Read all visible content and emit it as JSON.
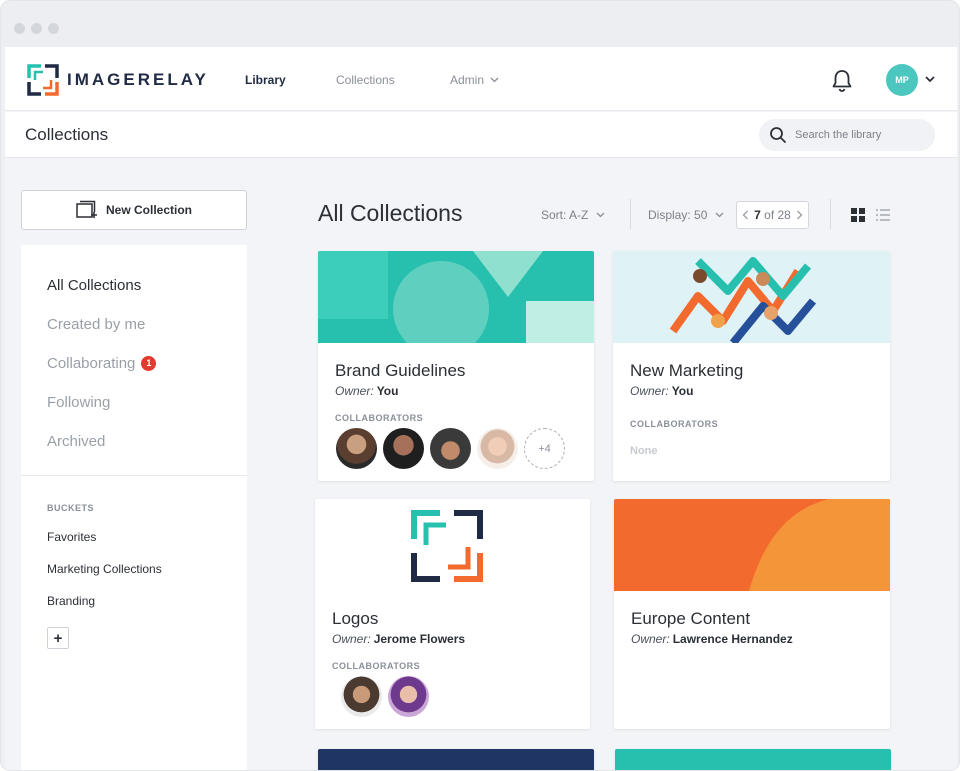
{
  "app": {
    "brand": "IMAGERELAY",
    "nav": [
      {
        "label": "Library",
        "active": true
      },
      {
        "label": "Collections",
        "active": false
      },
      {
        "label": "Admin",
        "active": false
      }
    ],
    "user_initials": "MP"
  },
  "subheader": {
    "title": "Collections",
    "search_placeholder": "Search the library"
  },
  "sidebar": {
    "new_collection_label": "New Collection",
    "items": [
      {
        "label": "All Collections",
        "active": true
      },
      {
        "label": "Created by me",
        "active": false
      },
      {
        "label": "Collaborating",
        "active": false,
        "badge": "1"
      },
      {
        "label": "Following",
        "active": false
      },
      {
        "label": "Archived",
        "active": false
      }
    ],
    "buckets_heading": "BUCKETS",
    "buckets": [
      "Favorites",
      "Marketing Collections",
      "Branding"
    ],
    "add_bucket_label": "+"
  },
  "main": {
    "title": "All Collections",
    "sort_label": "Sort: A-Z",
    "display_label": "Display: 50",
    "pager": {
      "current": "7",
      "of_label": "of 28"
    }
  },
  "cards": [
    {
      "title": "Brand Guidelines",
      "owner_label": "Owner:",
      "owner": "You",
      "collab_heading": "COLLABORATORS",
      "more": "+4"
    },
    {
      "title": "New Marketing",
      "owner_label": "Owner:",
      "owner": "You",
      "collab_heading": "COLLABORATORS",
      "none": "None"
    },
    {
      "title": "Logos",
      "owner_label": "Owner:",
      "owner": "Jerome Flowers",
      "collab_heading": "COLLABORATORS"
    },
    {
      "title": "Europe Content",
      "owner_label": "Owner:",
      "owner": "Lawrence Hernandez"
    }
  ],
  "colors": {
    "teal": "#27bfae",
    "brand_navy": "#1f2a44",
    "brand_orange": "#f26a2e",
    "badge_red": "#e23a2e"
  },
  "icons": [
    "bell-icon",
    "search-icon",
    "new-collection-icon",
    "chevron-down-icon",
    "grid-view-icon",
    "list-view-icon"
  ]
}
